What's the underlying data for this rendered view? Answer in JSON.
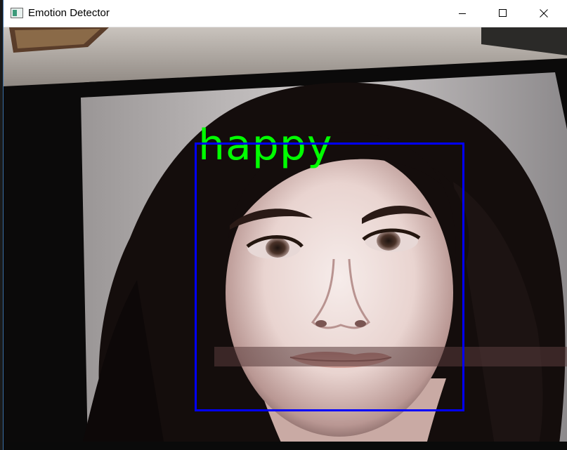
{
  "window": {
    "title": "Emotion Detector",
    "controls": {
      "minimize": "minimize",
      "maximize": "maximize",
      "close": "close"
    }
  },
  "detection": {
    "emotion": "happy",
    "label_color": "#00ff00",
    "box_color": "#0000ff"
  }
}
